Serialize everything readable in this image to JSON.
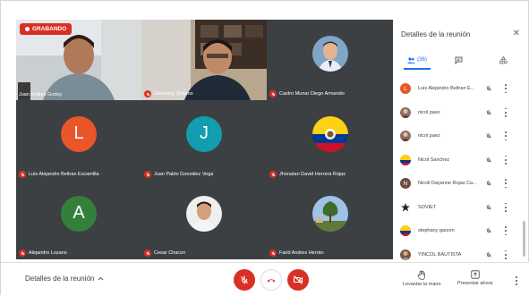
{
  "recording": {
    "label": "GRABANDO"
  },
  "tiles": [
    {
      "name": "Juan Andres Godoy",
      "kind": "video",
      "muted": false
    },
    {
      "name": "Giovanny Quijano",
      "kind": "video",
      "muted": true
    },
    {
      "name": "Castro Munar Diego Armando",
      "kind": "photo",
      "muted": true
    },
    {
      "name": "Luis Alejandro Beltran Escamilla",
      "kind": "letter",
      "letter": "L",
      "color": "#e8562a",
      "muted": true
    },
    {
      "name": "Juan Pablo González Vega",
      "kind": "letter",
      "letter": "J",
      "color": "#129eaf",
      "muted": true
    },
    {
      "name": "Jhonatan David Herrera Rojas",
      "kind": "flag",
      "muted": true
    },
    {
      "name": "Alejandro Lozano",
      "kind": "letter",
      "letter": "A",
      "color": "#34803a",
      "muted": true
    },
    {
      "name": "Cesar Chacon",
      "kind": "photo",
      "muted": true
    },
    {
      "name": "Farid Andres Herrán",
      "kind": "photo",
      "muted": true
    }
  ],
  "panel": {
    "title": "Detalles de la reunión",
    "participant_count": "(36)",
    "participants": [
      {
        "name": "Luis Alejandro Beltran E...",
        "avatar": "letter",
        "letter": "L",
        "color": "#e8562a"
      },
      {
        "name": "nicol paez",
        "avatar": "photo",
        "color": "#8d6e63"
      },
      {
        "name": "nicol paez",
        "avatar": "photo",
        "color": "#8d6e63"
      },
      {
        "name": "Nicol Sanchez",
        "avatar": "photo",
        "color": "#c99a3a"
      },
      {
        "name": "Nicoll Dayanne Rojas Ca...",
        "avatar": "letter",
        "letter": "N",
        "color": "#6d4c41"
      },
      {
        "name": "SOVIET",
        "avatar": "icon",
        "color": "#222222"
      },
      {
        "name": "stephany garzon",
        "avatar": "photo",
        "color": "#b08a2e"
      },
      {
        "name": "YINCOL BAUTISTA",
        "avatar": "photo",
        "color": "#795548"
      }
    ]
  },
  "bottom": {
    "meeting_details": "Detalles de la reunión",
    "raise_hand": "Levantar la mano",
    "present_now": "Presentar ahora"
  },
  "colors": {
    "danger": "#d93025",
    "accent": "#1a73e8",
    "grid_bg": "#202124",
    "tile_bg": "#3c4043"
  }
}
